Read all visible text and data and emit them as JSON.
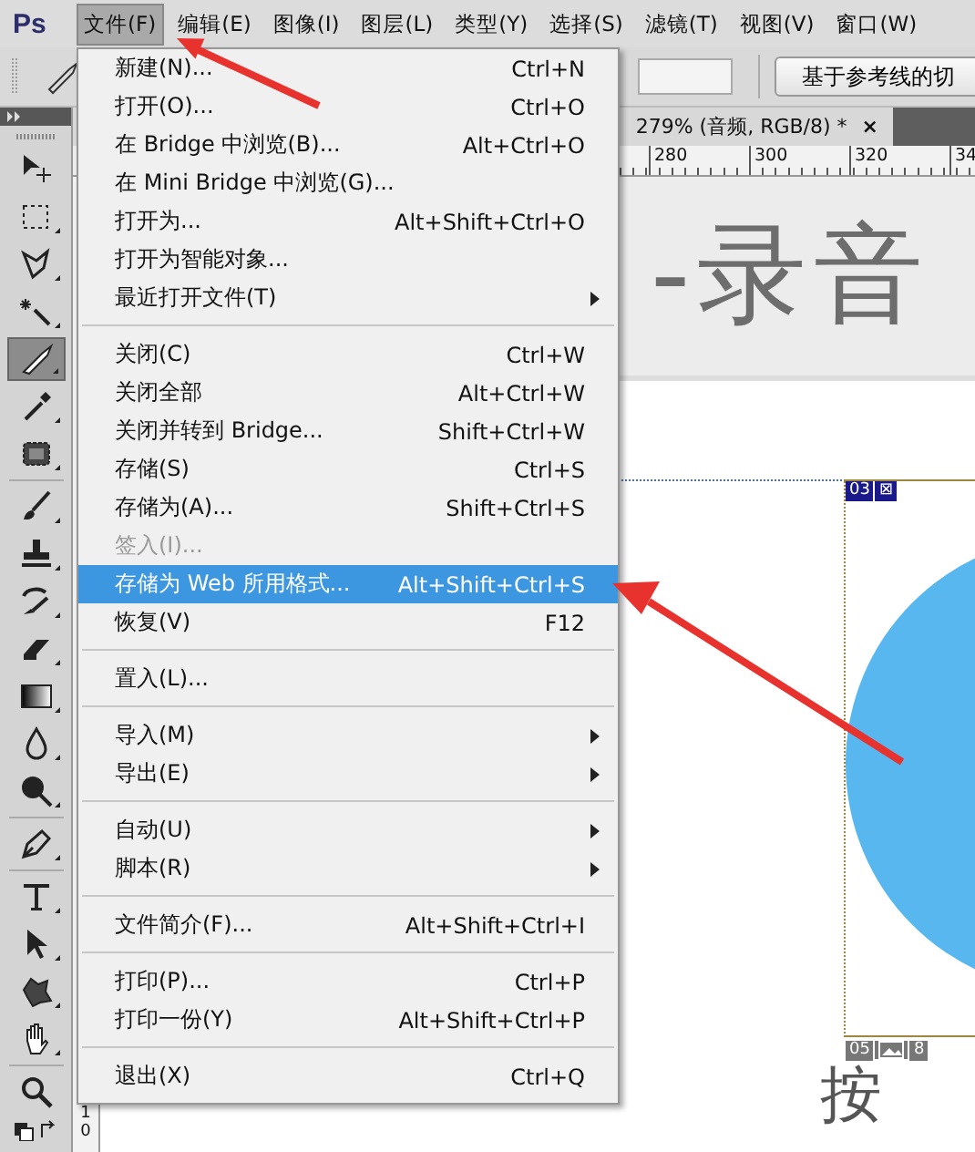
{
  "app": {
    "logo": "Ps"
  },
  "menubar": [
    {
      "label": "文件(F)",
      "selected": true
    },
    {
      "label": "编辑(E)",
      "selected": false
    },
    {
      "label": "图像(I)",
      "selected": false
    },
    {
      "label": "图层(L)",
      "selected": false
    },
    {
      "label": "类型(Y)",
      "selected": false
    },
    {
      "label": "选择(S)",
      "selected": false
    },
    {
      "label": "滤镜(T)",
      "selected": false
    },
    {
      "label": "视图(V)",
      "selected": false
    },
    {
      "label": "窗口(W)",
      "selected": false
    }
  ],
  "options_bar": {
    "button": "基于参考线的切"
  },
  "file_menu": [
    {
      "kind": "item",
      "label": "新建(N)...",
      "shortcut": "Ctrl+N",
      "submenu": false,
      "disabled": false,
      "selected": false
    },
    {
      "kind": "item",
      "label": "打开(O)...",
      "shortcut": "Ctrl+O",
      "submenu": false,
      "disabled": false,
      "selected": false
    },
    {
      "kind": "item",
      "label": "在 Bridge 中浏览(B)...",
      "shortcut": "Alt+Ctrl+O",
      "submenu": false,
      "disabled": false,
      "selected": false
    },
    {
      "kind": "item",
      "label": "在 Mini Bridge 中浏览(G)...",
      "submenu": false,
      "disabled": false,
      "selected": false
    },
    {
      "kind": "item",
      "label": "打开为...",
      "shortcut": "Alt+Shift+Ctrl+O",
      "submenu": false,
      "disabled": false,
      "selected": false
    },
    {
      "kind": "item",
      "label": "打开为智能对象...",
      "submenu": false,
      "disabled": false,
      "selected": false
    },
    {
      "kind": "item",
      "label": "最近打开文件(T)",
      "submenu": true,
      "disabled": false,
      "selected": false
    },
    {
      "kind": "separator"
    },
    {
      "kind": "item",
      "label": "关闭(C)",
      "shortcut": "Ctrl+W",
      "submenu": false,
      "disabled": false,
      "selected": false
    },
    {
      "kind": "item",
      "label": "关闭全部",
      "shortcut": "Alt+Ctrl+W",
      "submenu": false,
      "disabled": false,
      "selected": false
    },
    {
      "kind": "item",
      "label": "关闭并转到 Bridge...",
      "shortcut": "Shift+Ctrl+W",
      "submenu": false,
      "disabled": false,
      "selected": false
    },
    {
      "kind": "item",
      "label": "存储(S)",
      "shortcut": "Ctrl+S",
      "submenu": false,
      "disabled": false,
      "selected": false
    },
    {
      "kind": "item",
      "label": "存储为(A)...",
      "shortcut": "Shift+Ctrl+S",
      "submenu": false,
      "disabled": false,
      "selected": false
    },
    {
      "kind": "item",
      "label": "签入(I)...",
      "submenu": false,
      "disabled": true,
      "selected": false
    },
    {
      "kind": "item",
      "label": "存储为 Web 所用格式...",
      "shortcut": "Alt+Shift+Ctrl+S",
      "submenu": false,
      "disabled": false,
      "selected": true
    },
    {
      "kind": "item",
      "label": "恢复(V)",
      "shortcut": "F12",
      "submenu": false,
      "disabled": false,
      "selected": false
    },
    {
      "kind": "separator"
    },
    {
      "kind": "item",
      "label": "置入(L)...",
      "submenu": false,
      "disabled": false,
      "selected": false
    },
    {
      "kind": "separator"
    },
    {
      "kind": "item",
      "label": "导入(M)",
      "submenu": true,
      "disabled": false,
      "selected": false
    },
    {
      "kind": "item",
      "label": "导出(E)",
      "submenu": true,
      "disabled": false,
      "selected": false
    },
    {
      "kind": "separator"
    },
    {
      "kind": "item",
      "label": "自动(U)",
      "submenu": true,
      "disabled": false,
      "selected": false
    },
    {
      "kind": "item",
      "label": "脚本(R)",
      "submenu": true,
      "disabled": false,
      "selected": false
    },
    {
      "kind": "separator"
    },
    {
      "kind": "item",
      "label": "文件简介(F)...",
      "shortcut": "Alt+Shift+Ctrl+I",
      "submenu": false,
      "disabled": false,
      "selected": false
    },
    {
      "kind": "separator"
    },
    {
      "kind": "item",
      "label": "打印(P)...",
      "shortcut": "Ctrl+P",
      "submenu": false,
      "disabled": false,
      "selected": false
    },
    {
      "kind": "item",
      "label": "打印一份(Y)",
      "shortcut": "Alt+Shift+Ctrl+P",
      "submenu": false,
      "disabled": false,
      "selected": false
    },
    {
      "kind": "separator"
    },
    {
      "kind": "item",
      "label": "退出(X)",
      "shortcut": "Ctrl+Q",
      "submenu": false,
      "disabled": false,
      "selected": false
    }
  ],
  "toolbox": [
    {
      "kind": "move",
      "selected": false
    },
    {
      "kind": "marquee",
      "selected": false
    },
    {
      "kind": "lasso",
      "selected": false
    },
    {
      "kind": "wand",
      "selected": false
    },
    {
      "kind": "slice",
      "selected": true
    },
    {
      "kind": "eyedropper",
      "selected": false
    },
    {
      "kind": "healing",
      "selected": false
    },
    {
      "kind": "brush",
      "selected": false
    },
    {
      "kind": "stamp",
      "selected": false
    },
    {
      "kind": "history",
      "selected": false
    },
    {
      "kind": "eraser",
      "selected": false
    },
    {
      "kind": "gradient",
      "selected": false
    },
    {
      "kind": "blur",
      "selected": false
    },
    {
      "kind": "dodge",
      "selected": false
    },
    {
      "kind": "pen",
      "selected": false
    },
    {
      "kind": "type",
      "selected": false
    },
    {
      "kind": "path",
      "selected": false
    },
    {
      "kind": "shape",
      "selected": false
    },
    {
      "kind": "hand",
      "selected": false
    },
    {
      "kind": "zoom",
      "selected": false
    }
  ],
  "document": {
    "tab_title": "279% (音频, RGB/8) *",
    "close": "×",
    "ruler_marks": [
      "280",
      "300",
      "320",
      "34"
    ],
    "vertical_ruler_mark": "10",
    "heading": "-录音",
    "footer_text": "按",
    "slices": [
      {
        "number": "03",
        "badge": "⊠",
        "selected": true
      },
      {
        "number": "05",
        "selected": false,
        "extra": "8"
      }
    ]
  }
}
